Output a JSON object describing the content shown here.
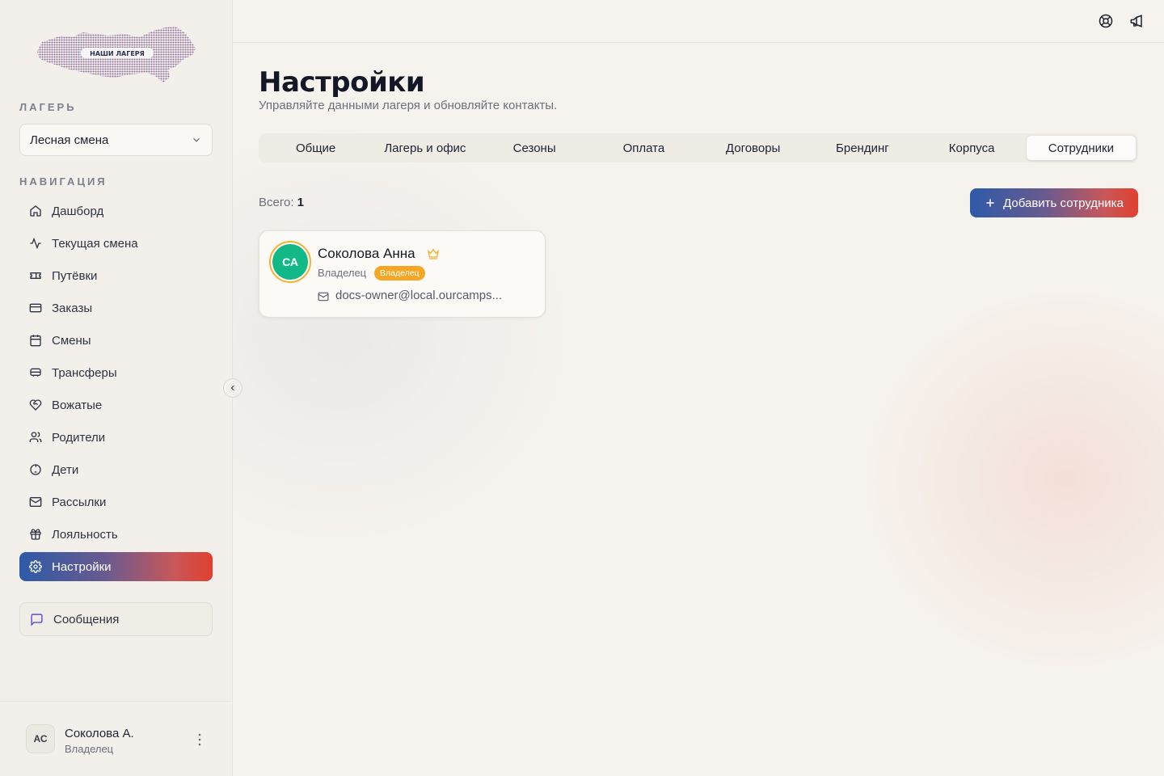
{
  "logo": {
    "text": "НАШИ ЛАГЕРЯ"
  },
  "sidebar": {
    "camp_label": "ЛАГЕРЬ",
    "camp_select": {
      "value": "Лесная смена"
    },
    "nav_label": "НАВИГАЦИЯ",
    "items": [
      {
        "label": "Дашборд",
        "icon": "home-icon"
      },
      {
        "label": "Текущая смена",
        "icon": "activity-icon"
      },
      {
        "label": "Путёвки",
        "icon": "ticket-icon"
      },
      {
        "label": "Заказы",
        "icon": "credit-card-icon"
      },
      {
        "label": "Смены",
        "icon": "calendar-icon"
      },
      {
        "label": "Трансферы",
        "icon": "bus-icon"
      },
      {
        "label": "Вожатые",
        "icon": "heart-handshake-icon"
      },
      {
        "label": "Родители",
        "icon": "users-icon"
      },
      {
        "label": "Дети",
        "icon": "baby-icon"
      },
      {
        "label": "Рассылки",
        "icon": "mail-icon"
      },
      {
        "label": "Лояльность",
        "icon": "gift-icon"
      },
      {
        "label": "Настройки",
        "icon": "settings-icon",
        "active": true
      }
    ],
    "messages_label": "Сообщения",
    "user": {
      "initials": "АС",
      "name": "Соколова А.",
      "role": "Владелец"
    }
  },
  "header": {
    "icons": [
      "help-lifebuoy-icon",
      "megaphone-icon"
    ]
  },
  "main": {
    "title": "Настройки",
    "subtitle": "Управляйте данными лагеря и обновляйте контакты.",
    "tabs": [
      {
        "label": "Общие"
      },
      {
        "label": "Лагерь и офис"
      },
      {
        "label": "Сезоны"
      },
      {
        "label": "Оплата"
      },
      {
        "label": "Договоры"
      },
      {
        "label": "Брендинг"
      },
      {
        "label": "Корпуса"
      },
      {
        "label": "Сотрудники",
        "active": true
      }
    ],
    "total_label": "Всего:",
    "total_count": "1",
    "add_button": "Добавить сотрудника",
    "staff": [
      {
        "initials": "СА",
        "name": "Соколова Анна",
        "role": "Владелец",
        "badge": "Владелец",
        "email": "docs-owner@local.ourcamps..."
      }
    ]
  },
  "colors": {
    "accent_gradient_start": "#2e5aa8",
    "accent_gradient_end": "#e0402e",
    "avatar_green": "#12b886",
    "badge_orange": "#f5a623",
    "crown_gold": "#f2b233"
  }
}
